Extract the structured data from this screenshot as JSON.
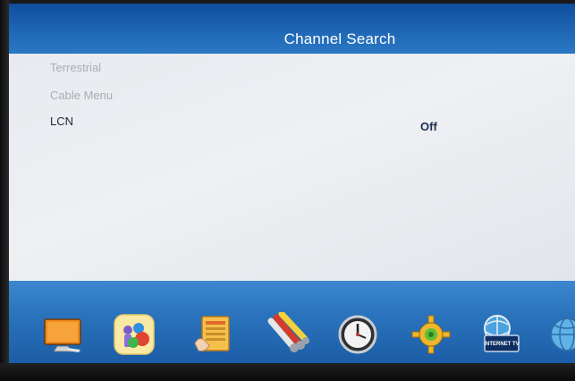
{
  "header": {
    "title": "Channel Search"
  },
  "menu": {
    "items": [
      {
        "label": "Terrestrial",
        "state": "disabled"
      },
      {
        "label": "Cable Menu",
        "state": "disabled"
      },
      {
        "label": "LCN",
        "state": "selected",
        "value": "Off"
      }
    ]
  },
  "dock": {
    "icons": [
      {
        "name": "tv-monitor-icon"
      },
      {
        "name": "media-icon"
      },
      {
        "name": "program-guide-icon"
      },
      {
        "name": "av-cables-icon"
      },
      {
        "name": "clock-icon"
      },
      {
        "name": "settings-gear-icon"
      },
      {
        "name": "internet-tv-icon",
        "text": "INTERNET TV"
      },
      {
        "name": "globe-icon"
      }
    ]
  },
  "colors": {
    "title_bar": "#1f67b5",
    "content_bg": "#e9ecf0",
    "dock_bg": "#2b74bd",
    "value_text": "#1d2e52"
  }
}
